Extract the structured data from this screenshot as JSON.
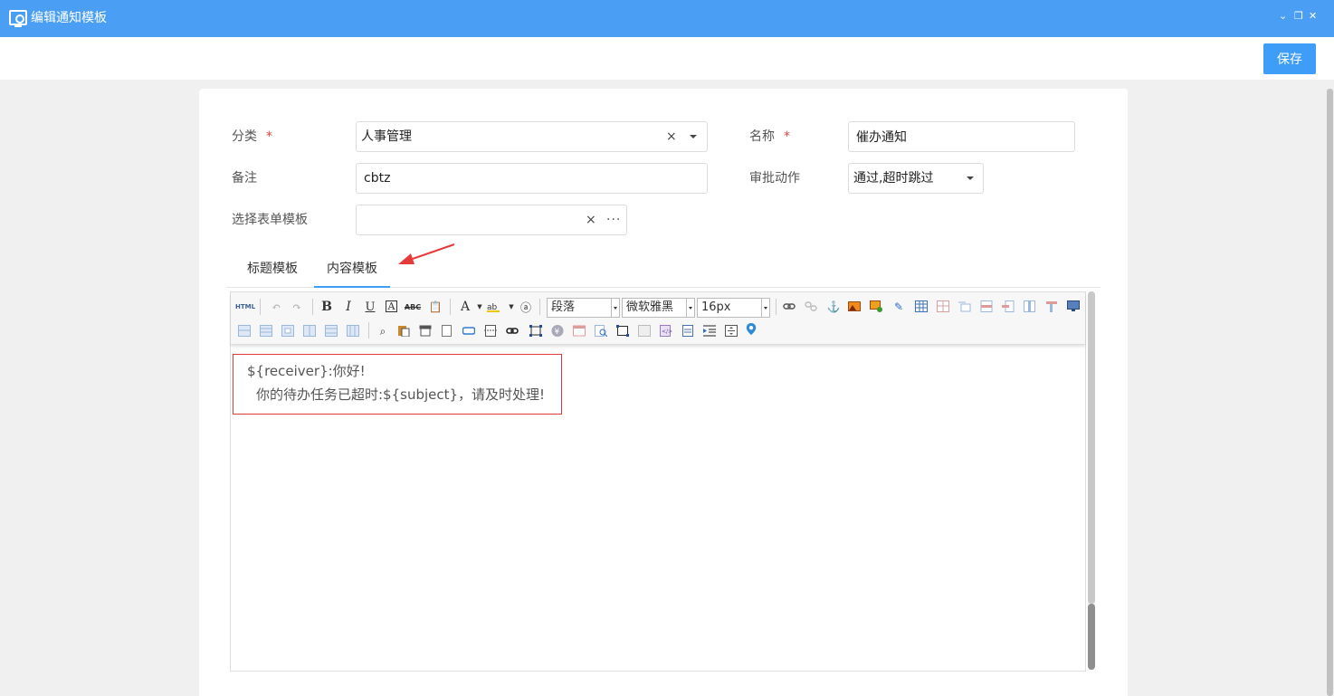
{
  "window": {
    "title": "编辑通知模板",
    "controls": {
      "collapse": "⌄",
      "restore": "❐",
      "close": "✕"
    }
  },
  "actions": {
    "save_label": "保存"
  },
  "form": {
    "category": {
      "label": "分类",
      "required_mark": "*",
      "value": "人事管理",
      "clear": "×"
    },
    "name": {
      "label": "名称",
      "required_mark": "*",
      "value": "催办通知"
    },
    "remark": {
      "label": "备注",
      "value": "cbtz"
    },
    "approval_action": {
      "label": "审批动作",
      "value": "通过,超时跳过"
    },
    "form_template": {
      "label": "选择表单模板",
      "value": "",
      "clear": "×",
      "more": "···"
    }
  },
  "tabs": [
    {
      "label": "标题模板",
      "active": false
    },
    {
      "label": "内容模板",
      "active": true
    }
  ],
  "toolbar": {
    "html_label": "HTML",
    "bold": "B",
    "italic": "I",
    "underline": "U",
    "font_border": "A",
    "strikethrough": "ABC",
    "font_color": "A",
    "paragraph": "段落",
    "font_family": "微软雅黑",
    "font_size": "16px"
  },
  "content": {
    "line1": "${receiver}:你好!",
    "line2": "你的待办任务已超时:${subject}，请及时处理!"
  },
  "colors": {
    "header": "#4a9ff5",
    "primary": "#3e9df7",
    "required": "#e04444",
    "highlight_border": "#e03a3a",
    "arrow": "#e63b3b"
  }
}
